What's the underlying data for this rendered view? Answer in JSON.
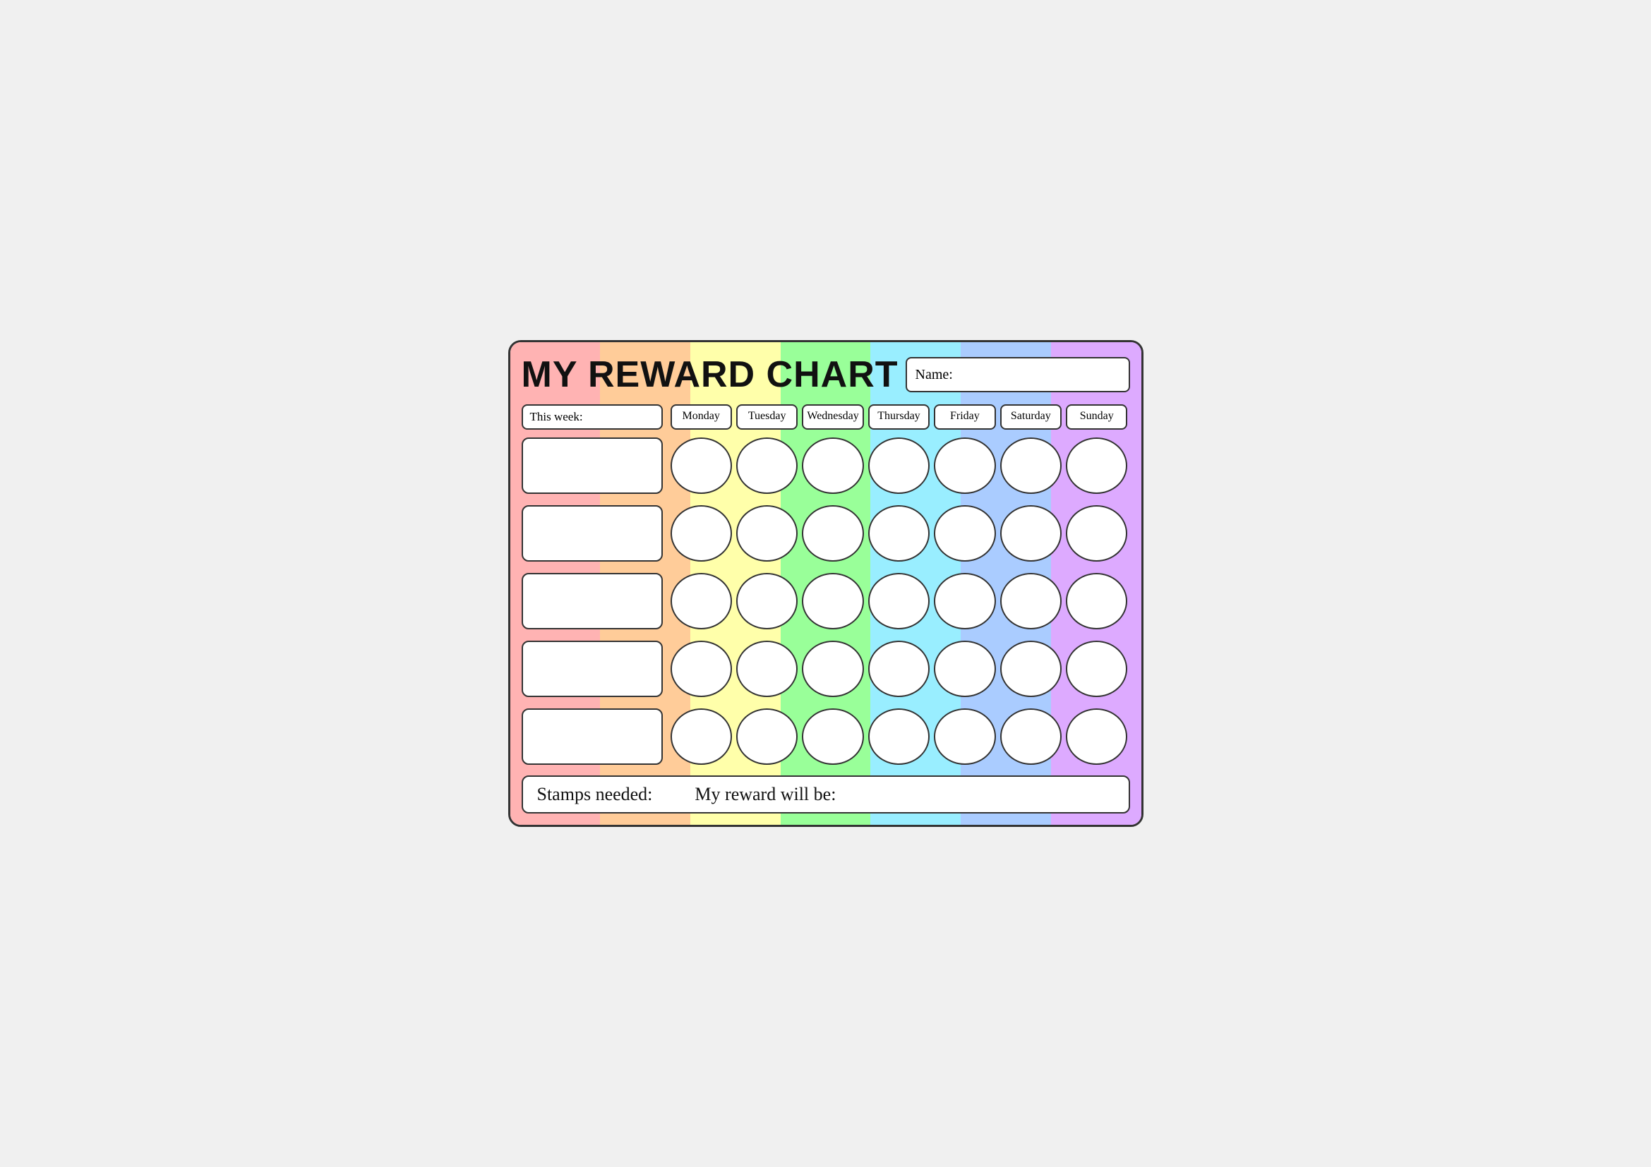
{
  "title": "MY REWARD CHART",
  "name_label": "Name:",
  "this_week_label": "This week:",
  "days": [
    "Monday",
    "Tuesday",
    "Wednesday",
    "Thursday",
    "Friday",
    "Saturday",
    "Sunday"
  ],
  "num_task_rows": 5,
  "footer_stamps": "Stamps needed:",
  "footer_reward": "My reward will be:",
  "rainbow_colors": [
    "#ffaaaa",
    "#ffccaa",
    "#ffeeaa",
    "#aaffaa",
    "#aaeeff",
    "#aaccff",
    "#ddaaff"
  ],
  "background_colors": {
    "monday": "#ffb3b3",
    "tuesday": "#ffcc99",
    "wednesday": "#ffffaa",
    "thursday": "#99ff99",
    "friday": "#99eeff",
    "saturday": "#aaccff",
    "sunday": "#ddaaff"
  }
}
